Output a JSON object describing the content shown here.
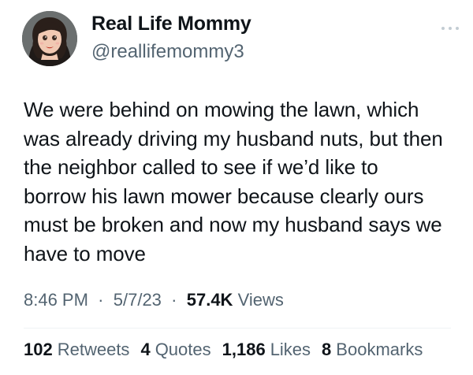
{
  "author": {
    "name": "Real Life Mommy",
    "handle": "@reallifemommy3"
  },
  "tweet": {
    "text": "We were behind on mowing the lawn, which\nwas already driving my husband nuts, but then\nthe neighbor called to see if we’d like to\nborrow his lawn mower because clearly ours\nmust be broken and now my husband says we\nhave to move"
  },
  "meta": {
    "time": "8:46 PM",
    "separator": "·",
    "date": "5/7/23",
    "views_count": "57.4K",
    "views_label": "Views"
  },
  "stats": {
    "retweets": {
      "count": "102",
      "label": "Retweets"
    },
    "quotes": {
      "count": "4",
      "label": "Quotes"
    },
    "likes": {
      "count": "1,186",
      "label": "Likes"
    },
    "bookmarks": {
      "count": "8",
      "label": "Bookmarks"
    }
  },
  "icons": {
    "more": "more-horizontal-icon"
  },
  "colors": {
    "text": "#0f1419",
    "secondary": "#536471",
    "divider": "#eff3f4"
  }
}
